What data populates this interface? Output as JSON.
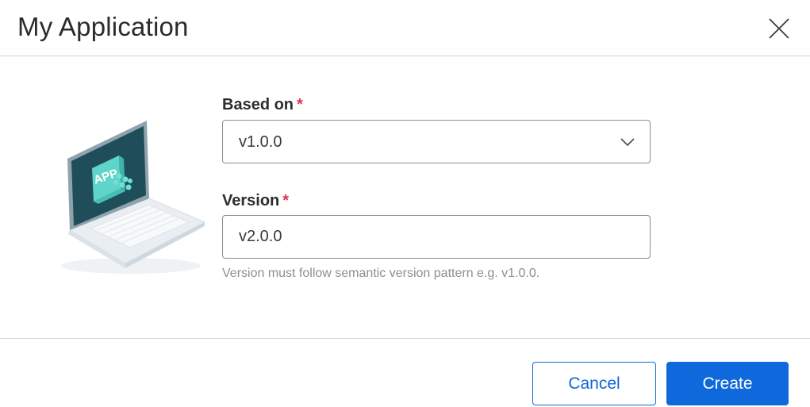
{
  "dialog": {
    "title": "My Application",
    "close_icon": "close-icon"
  },
  "illustration": {
    "icon": "laptop-app-illustration",
    "screen_text": "APP",
    "colors": {
      "screen": "#1f4d59",
      "tile": "#5fd4c8",
      "body": "#f1f4f6"
    }
  },
  "form": {
    "based_on": {
      "label": "Based on",
      "required_mark": "*",
      "value": "v1.0.0"
    },
    "version": {
      "label": "Version",
      "required_mark": "*",
      "value": "v2.0.0",
      "hint": "Version must follow semantic version pattern e.g. v1.0.0."
    }
  },
  "footer": {
    "cancel_label": "Cancel",
    "create_label": "Create"
  },
  "colors": {
    "primary": "#0f69dc",
    "required": "#e5304f",
    "hint": "#8e8e8e"
  }
}
